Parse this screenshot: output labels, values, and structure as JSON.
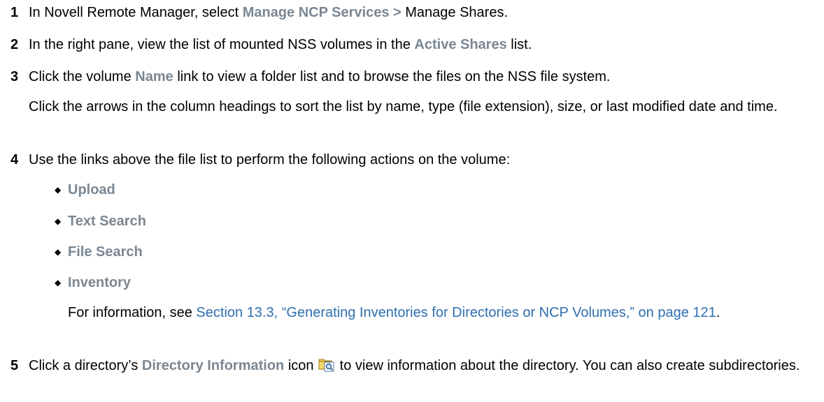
{
  "steps": [
    {
      "num": "1",
      "pre": "In Novell Remote Manager, select ",
      "ui1": "Manage NCP Services >",
      "post": " Manage Shares."
    },
    {
      "num": "2",
      "pre": "In the right pane, view the list of mounted NSS volumes in the ",
      "ui1": "Active Shares",
      "post": " list."
    },
    {
      "num": "3",
      "pre": "Click the volume ",
      "ui1": "Name",
      "post": " link to view a folder list and to browse the files on the NSS file system."
    },
    {
      "num": "4",
      "text": "Use the links above the file list to perform the following actions on the volume:"
    },
    {
      "num": "5",
      "pre": "Click a directory’s ",
      "ui1": "Directory Information",
      "mid": " icon",
      "post": " to view information about the directory. You can also create subdirectories."
    }
  ],
  "step3_note": "Click the arrows in the column headings to sort the list by name, type (file extension), size, or last modified date and time.",
  "bullets": [
    "Upload",
    "Text Search",
    "File Search",
    "Inventory"
  ],
  "inventory_note": {
    "pre": "For information, see ",
    "link": "Section 13.3, “Generating Inventories for Directories or NCP Volumes,” on page 121",
    "post": "."
  },
  "icons": {
    "directory_info": "folder-magnifier-icon"
  }
}
